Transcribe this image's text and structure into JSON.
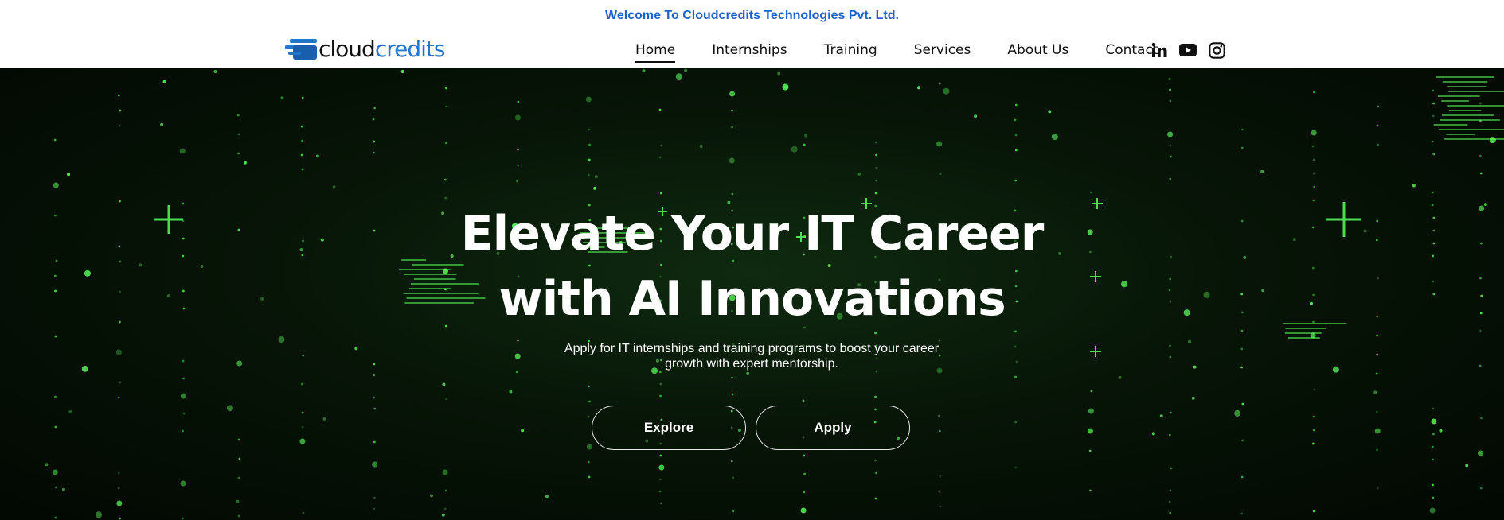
{
  "welcome": "Welcome To Cloudcredits Technologies Pvt. Ltd.",
  "logo": {
    "part1": "cloud",
    "part2": "credits"
  },
  "nav": {
    "items": [
      {
        "label": "Home",
        "active": true
      },
      {
        "label": "Internships"
      },
      {
        "label": "Training"
      },
      {
        "label": "Services"
      },
      {
        "label": "About Us"
      },
      {
        "label": "Contact"
      }
    ]
  },
  "social": [
    "linkedin-icon",
    "youtube-icon",
    "instagram-icon"
  ],
  "hero": {
    "title_line1": "Elevate Your IT Career",
    "title_line2": "with AI Innovations",
    "subtitle_line1": "Apply for IT internships and training programs to boost your career",
    "subtitle_line2": "growth with expert mentorship.",
    "explore_label": "Explore",
    "apply_label": "Apply"
  },
  "colors": {
    "brand_blue": "#2277cc",
    "welcome_blue": "#1e63c8",
    "matrix_green": "#5cff5c"
  }
}
